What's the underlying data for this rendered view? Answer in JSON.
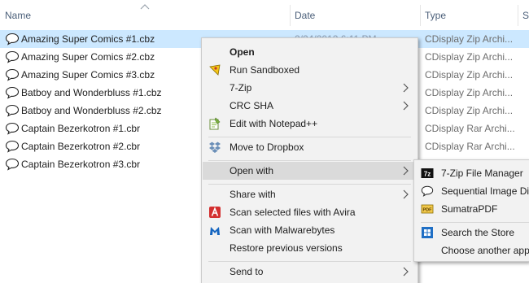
{
  "columns": {
    "name": "Name",
    "date": "Date",
    "type": "Type",
    "size": "S"
  },
  "files": [
    {
      "name": "Amazing Super Comics #1.cbz",
      "date": "2/24/2012 6:11 PM",
      "type": "CDisplay Zip Archi...",
      "selected": true
    },
    {
      "name": "Amazing Super Comics #2.cbz",
      "date": "",
      "type": "CDisplay Zip Archi..."
    },
    {
      "name": "Amazing Super Comics #3.cbz",
      "date": "",
      "type": "CDisplay Zip Archi..."
    },
    {
      "name": "Batboy and Wonderbluss #1.cbz",
      "date": "",
      "type": "CDisplay Zip Archi..."
    },
    {
      "name": "Batboy and Wonderbluss #2.cbz",
      "date": "",
      "type": "CDisplay Zip Archi..."
    },
    {
      "name": "Captain Bezerkotron #1.cbr",
      "date": "",
      "type": "CDisplay Rar Archi..."
    },
    {
      "name": "Captain Bezerkotron #2.cbr",
      "date": "",
      "type": "CDisplay Rar Archi..."
    },
    {
      "name": "Captain Bezerkotron #3.cbr",
      "date": "",
      "type": "CDisplay Rar Archi..."
    }
  ],
  "context_menu": {
    "items": [
      {
        "label": "Open",
        "bold": true,
        "icon": ""
      },
      {
        "label": "Run Sandboxed",
        "icon": "sandboxie-icon"
      },
      {
        "label": "7-Zip",
        "icon": "",
        "submenu": true
      },
      {
        "label": "CRC SHA",
        "icon": "",
        "submenu": true
      },
      {
        "label": "Edit with Notepad++",
        "icon": "notepad-plus-plus-icon"
      },
      {
        "label": "Move to Dropbox",
        "icon": "dropbox-icon"
      },
      {
        "label": "Open with",
        "icon": "",
        "submenu": true,
        "highlighted": true
      },
      {
        "label": "Share with",
        "icon": "",
        "submenu": true
      },
      {
        "label": "Scan selected files with Avira",
        "icon": "avira-icon"
      },
      {
        "label": "Scan with Malwarebytes",
        "icon": "malwarebytes-icon"
      },
      {
        "label": "Restore previous versions",
        "icon": ""
      },
      {
        "label": "Send to",
        "icon": "",
        "submenu": true
      }
    ]
  },
  "open_with_submenu": {
    "items": [
      {
        "label": "7-Zip File Manager",
        "icon": "7zip-icon"
      },
      {
        "label": "Sequential Image Dis",
        "icon": "speech-bubble-icon"
      },
      {
        "label": "SumatraPDF",
        "icon": "pdf-icon"
      },
      {
        "label": "Search the Store",
        "icon": "store-icon"
      },
      {
        "label": "Choose another app",
        "icon": ""
      }
    ]
  },
  "colors": {
    "selection": "#cce8ff",
    "menu_background": "#f2f2f2",
    "menu_highlight": "#dadada",
    "header_text": "#4c607a"
  }
}
